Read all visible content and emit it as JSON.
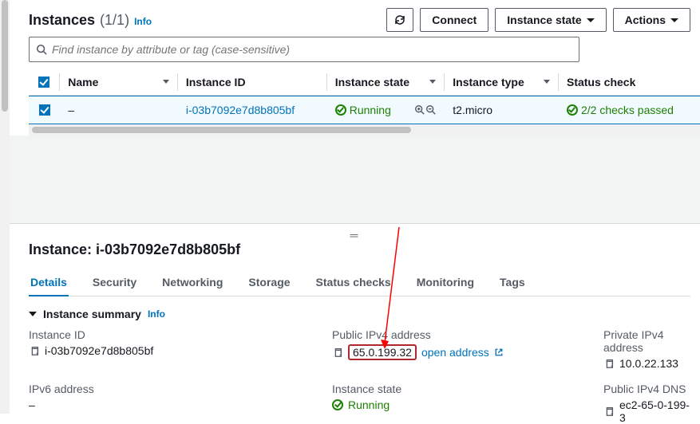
{
  "header": {
    "title": "Instances",
    "count": "(1/1)",
    "info": "Info",
    "buttons": {
      "refresh": "⟳",
      "connect": "Connect",
      "instance_state": "Instance state",
      "actions": "Actions"
    }
  },
  "search": {
    "placeholder": "Find instance by attribute or tag (case-sensitive)"
  },
  "table": {
    "columns": [
      "Name",
      "Instance ID",
      "Instance state",
      "Instance type",
      "Status check"
    ],
    "rows": [
      {
        "name": "–",
        "instance_id": "i-03b7092e7d8b805bf",
        "state": "Running",
        "type": "t2.micro",
        "status": "2/2 checks passed"
      }
    ]
  },
  "panel": {
    "title_prefix": "Instance: ",
    "title_id": "i-03b7092e7d8b805bf",
    "tabs": [
      "Details",
      "Security",
      "Networking",
      "Storage",
      "Status checks",
      "Monitoring",
      "Tags"
    ],
    "summary_heading": "Instance summary",
    "info": "Info"
  },
  "kv": {
    "instance_id": {
      "label": "Instance ID",
      "value": "i-03b7092e7d8b805bf"
    },
    "public_ipv4": {
      "label": "Public IPv4 address",
      "value": "65.0.199.32",
      "open": "open address"
    },
    "private_ipv4": {
      "label": "Private IPv4 address",
      "value": "10.0.22.133"
    },
    "ipv6": {
      "label": "IPv6 address",
      "value": "–"
    },
    "instance_state": {
      "label": "Instance state",
      "value": "Running"
    },
    "public_dns": {
      "label": "Public IPv4 DNS",
      "value": "ec2-65-0-199-3"
    }
  }
}
